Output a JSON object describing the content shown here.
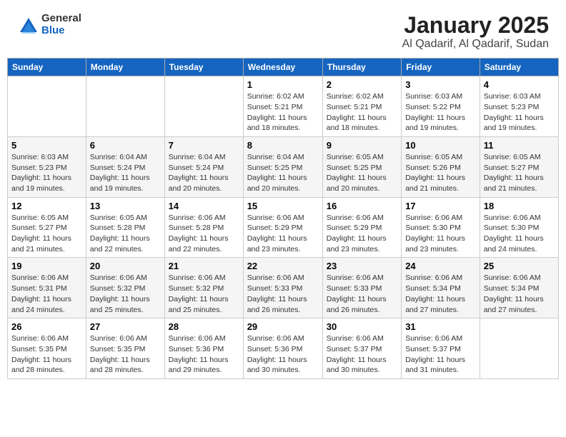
{
  "header": {
    "logo_general": "General",
    "logo_blue": "Blue",
    "title": "January 2025",
    "subtitle": "Al Qadarif, Al Qadarif, Sudan"
  },
  "days_of_week": [
    "Sunday",
    "Monday",
    "Tuesday",
    "Wednesday",
    "Thursday",
    "Friday",
    "Saturday"
  ],
  "weeks": [
    [
      {
        "day": "",
        "info": ""
      },
      {
        "day": "",
        "info": ""
      },
      {
        "day": "",
        "info": ""
      },
      {
        "day": "1",
        "info": "Sunrise: 6:02 AM\nSunset: 5:21 PM\nDaylight: 11 hours and 18 minutes."
      },
      {
        "day": "2",
        "info": "Sunrise: 6:02 AM\nSunset: 5:21 PM\nDaylight: 11 hours and 18 minutes."
      },
      {
        "day": "3",
        "info": "Sunrise: 6:03 AM\nSunset: 5:22 PM\nDaylight: 11 hours and 19 minutes."
      },
      {
        "day": "4",
        "info": "Sunrise: 6:03 AM\nSunset: 5:23 PM\nDaylight: 11 hours and 19 minutes."
      }
    ],
    [
      {
        "day": "5",
        "info": "Sunrise: 6:03 AM\nSunset: 5:23 PM\nDaylight: 11 hours and 19 minutes."
      },
      {
        "day": "6",
        "info": "Sunrise: 6:04 AM\nSunset: 5:24 PM\nDaylight: 11 hours and 19 minutes."
      },
      {
        "day": "7",
        "info": "Sunrise: 6:04 AM\nSunset: 5:24 PM\nDaylight: 11 hours and 20 minutes."
      },
      {
        "day": "8",
        "info": "Sunrise: 6:04 AM\nSunset: 5:25 PM\nDaylight: 11 hours and 20 minutes."
      },
      {
        "day": "9",
        "info": "Sunrise: 6:05 AM\nSunset: 5:25 PM\nDaylight: 11 hours and 20 minutes."
      },
      {
        "day": "10",
        "info": "Sunrise: 6:05 AM\nSunset: 5:26 PM\nDaylight: 11 hours and 21 minutes."
      },
      {
        "day": "11",
        "info": "Sunrise: 6:05 AM\nSunset: 5:27 PM\nDaylight: 11 hours and 21 minutes."
      }
    ],
    [
      {
        "day": "12",
        "info": "Sunrise: 6:05 AM\nSunset: 5:27 PM\nDaylight: 11 hours and 21 minutes."
      },
      {
        "day": "13",
        "info": "Sunrise: 6:05 AM\nSunset: 5:28 PM\nDaylight: 11 hours and 22 minutes."
      },
      {
        "day": "14",
        "info": "Sunrise: 6:06 AM\nSunset: 5:28 PM\nDaylight: 11 hours and 22 minutes."
      },
      {
        "day": "15",
        "info": "Sunrise: 6:06 AM\nSunset: 5:29 PM\nDaylight: 11 hours and 23 minutes."
      },
      {
        "day": "16",
        "info": "Sunrise: 6:06 AM\nSunset: 5:29 PM\nDaylight: 11 hours and 23 minutes."
      },
      {
        "day": "17",
        "info": "Sunrise: 6:06 AM\nSunset: 5:30 PM\nDaylight: 11 hours and 23 minutes."
      },
      {
        "day": "18",
        "info": "Sunrise: 6:06 AM\nSunset: 5:30 PM\nDaylight: 11 hours and 24 minutes."
      }
    ],
    [
      {
        "day": "19",
        "info": "Sunrise: 6:06 AM\nSunset: 5:31 PM\nDaylight: 11 hours and 24 minutes."
      },
      {
        "day": "20",
        "info": "Sunrise: 6:06 AM\nSunset: 5:32 PM\nDaylight: 11 hours and 25 minutes."
      },
      {
        "day": "21",
        "info": "Sunrise: 6:06 AM\nSunset: 5:32 PM\nDaylight: 11 hours and 25 minutes."
      },
      {
        "day": "22",
        "info": "Sunrise: 6:06 AM\nSunset: 5:33 PM\nDaylight: 11 hours and 26 minutes."
      },
      {
        "day": "23",
        "info": "Sunrise: 6:06 AM\nSunset: 5:33 PM\nDaylight: 11 hours and 26 minutes."
      },
      {
        "day": "24",
        "info": "Sunrise: 6:06 AM\nSunset: 5:34 PM\nDaylight: 11 hours and 27 minutes."
      },
      {
        "day": "25",
        "info": "Sunrise: 6:06 AM\nSunset: 5:34 PM\nDaylight: 11 hours and 27 minutes."
      }
    ],
    [
      {
        "day": "26",
        "info": "Sunrise: 6:06 AM\nSunset: 5:35 PM\nDaylight: 11 hours and 28 minutes."
      },
      {
        "day": "27",
        "info": "Sunrise: 6:06 AM\nSunset: 5:35 PM\nDaylight: 11 hours and 28 minutes."
      },
      {
        "day": "28",
        "info": "Sunrise: 6:06 AM\nSunset: 5:36 PM\nDaylight: 11 hours and 29 minutes."
      },
      {
        "day": "29",
        "info": "Sunrise: 6:06 AM\nSunset: 5:36 PM\nDaylight: 11 hours and 30 minutes."
      },
      {
        "day": "30",
        "info": "Sunrise: 6:06 AM\nSunset: 5:37 PM\nDaylight: 11 hours and 30 minutes."
      },
      {
        "day": "31",
        "info": "Sunrise: 6:06 AM\nSunset: 5:37 PM\nDaylight: 11 hours and 31 minutes."
      },
      {
        "day": "",
        "info": ""
      }
    ]
  ]
}
